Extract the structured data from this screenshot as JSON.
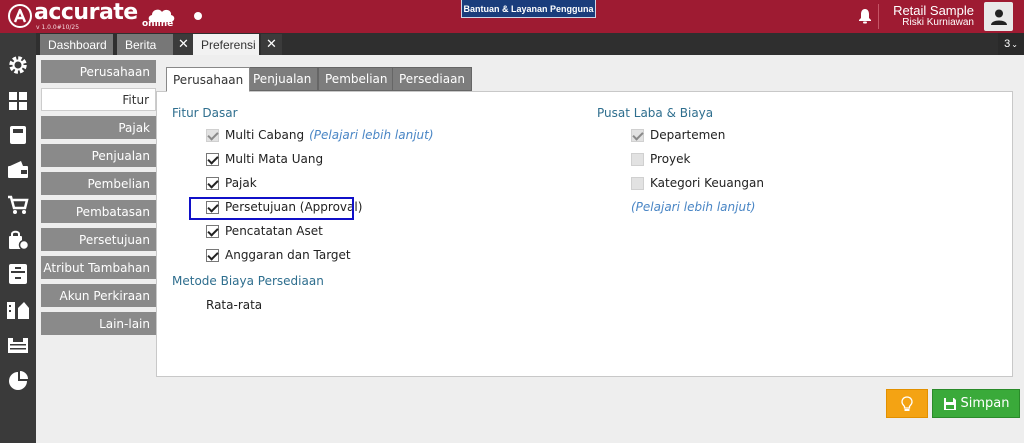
{
  "header": {
    "logo_word": "accurate",
    "logo_online": "online",
    "logo_version": "v 1.0.0#10/25",
    "help_label": "Bantuan & Layanan Pengguna",
    "company_name": "Retail Sample",
    "user_name": "Riski Kurniawan"
  },
  "tabs": [
    {
      "label": "Dashboard"
    },
    {
      "label": "Berita"
    },
    {
      "label": "Preferensi"
    }
  ],
  "tab_count": "3",
  "side_menu": [
    {
      "label": "Perusahaan",
      "active": false
    },
    {
      "label": "Fitur",
      "active": true
    },
    {
      "label": "Pajak",
      "active": false
    },
    {
      "label": "Penjualan",
      "active": false
    },
    {
      "label": "Pembelian",
      "active": false
    },
    {
      "label": "Pembatasan",
      "active": false
    },
    {
      "label": "Persetujuan",
      "active": false
    },
    {
      "label": "Atribut Tambahan",
      "active": false
    },
    {
      "label": "Akun Perkiraan",
      "active": false
    },
    {
      "label": "Lain-lain",
      "active": false
    }
  ],
  "panel_tabs": [
    {
      "label": "Perusahaan",
      "active": true
    },
    {
      "label": "Penjualan",
      "active": false
    },
    {
      "label": "Pembelian",
      "active": false
    },
    {
      "label": "Persediaan",
      "active": false
    }
  ],
  "fitur_dasar": {
    "title": "Fitur Dasar",
    "options": [
      {
        "label": "Multi Cabang",
        "checked": true,
        "disabled": true,
        "link": "(Pelajari lebih lanjut)"
      },
      {
        "label": "Multi Mata Uang",
        "checked": true,
        "disabled": false
      },
      {
        "label": "Pajak",
        "checked": true,
        "disabled": false
      },
      {
        "label": "Persetujuan (Approval)",
        "checked": true,
        "disabled": false
      },
      {
        "label": "Pencatatan Aset",
        "checked": true,
        "disabled": false
      },
      {
        "label": "Anggaran dan Target",
        "checked": true,
        "disabled": false
      }
    ]
  },
  "metode": {
    "title": "Metode Biaya Persediaan",
    "value": "Rata-rata"
  },
  "pusat_laba": {
    "title": "Pusat Laba & Biaya",
    "options": [
      {
        "label": "Departemen",
        "checked": true,
        "disabled": true
      },
      {
        "label": "Proyek",
        "checked": false,
        "disabled": true
      },
      {
        "label": "Kategori Keuangan",
        "checked": false,
        "disabled": true
      }
    ],
    "link": "(Pelajari lebih lanjut)"
  },
  "actions": {
    "save_label": "Simpan"
  },
  "colors": {
    "brand": "#9e1b32",
    "save": "#3aaa3a",
    "hint": "#f4a313",
    "section_title": "#2e6e8e",
    "highlight": "#1010c8"
  }
}
